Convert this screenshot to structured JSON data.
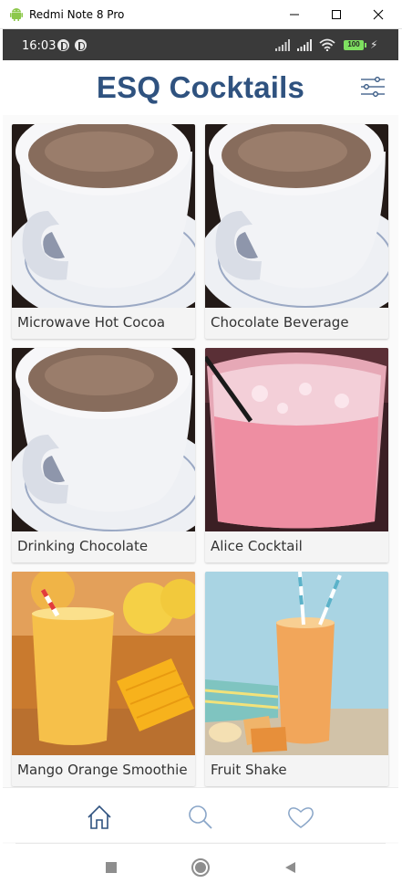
{
  "window": {
    "title": "Redmi Note 8 Pro",
    "icon": "android-icon",
    "controls": [
      "minimize-icon",
      "maximize-icon",
      "close-icon"
    ]
  },
  "status_bar": {
    "time": "16:03",
    "battery": "100",
    "icons": [
      "notification-icon",
      "notification-icon",
      "signal-icon",
      "signal-icon",
      "wifi-icon",
      "battery-icon",
      "charging-icon"
    ]
  },
  "app": {
    "title": "ESQ Cocktails",
    "filter_icon": "filter-sliders-icon",
    "title_color": "#2f527f"
  },
  "drinks": [
    {
      "name": "Microwave Hot Cocoa",
      "kind": "cocoa"
    },
    {
      "name": "Chocolate Beverage",
      "kind": "cocoa"
    },
    {
      "name": "Drinking Chocolate",
      "kind": "cocoa"
    },
    {
      "name": "Alice Cocktail",
      "kind": "pink"
    },
    {
      "name": "Mango Orange Smoothie",
      "kind": "mango"
    },
    {
      "name": "Fruit Shake",
      "kind": "shake"
    }
  ],
  "bottom_nav": {
    "items": [
      {
        "icon": "home-icon",
        "active": true
      },
      {
        "icon": "search-icon",
        "active": false
      },
      {
        "icon": "heart-icon",
        "active": false
      }
    ],
    "active_color": "#2f527f",
    "inactive_color": "#8aa6c8"
  },
  "system_nav": [
    "recents-icon",
    "home-circle-icon",
    "back-icon"
  ]
}
